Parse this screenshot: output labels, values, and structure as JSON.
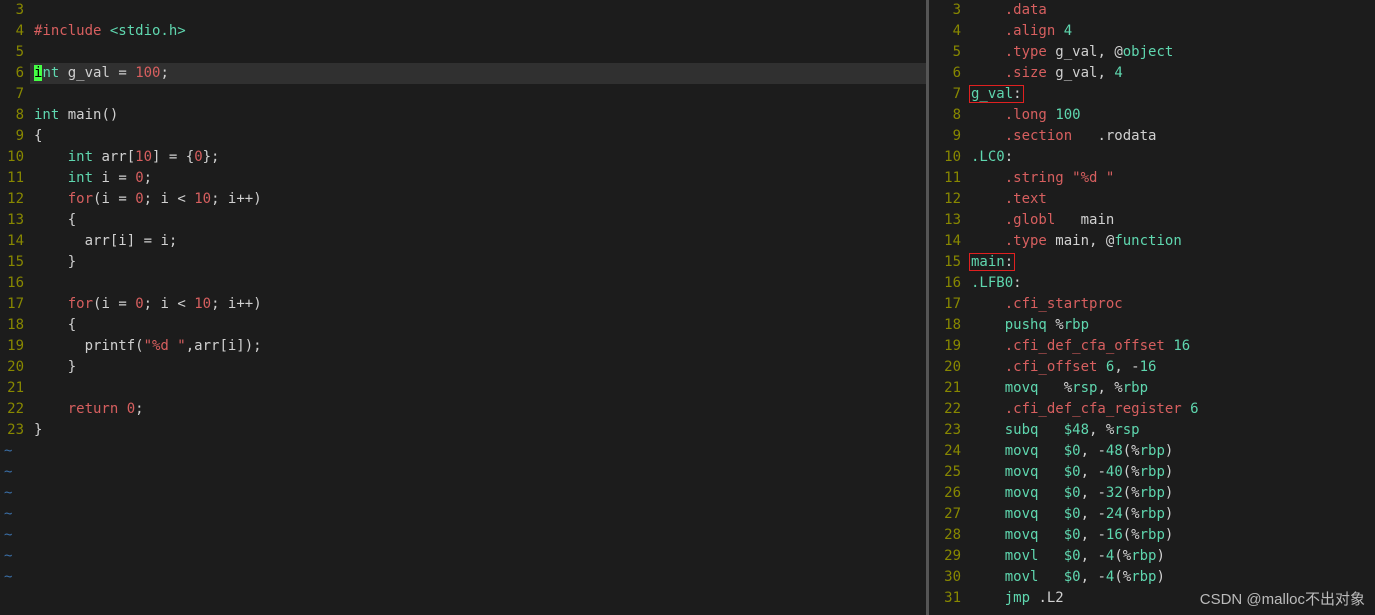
{
  "watermark": "CSDN @malloc不出对象",
  "left": {
    "lines": [
      {
        "n": 3,
        "tokens": []
      },
      {
        "n": 4,
        "tokens": [
          {
            "t": "#include ",
            "c": "pink"
          },
          {
            "t": "<stdio.h>",
            "c": "teal"
          }
        ]
      },
      {
        "n": 5,
        "tokens": []
      },
      {
        "n": 6,
        "hl": true,
        "tokens": [
          {
            "t": "i",
            "c": "cursor"
          },
          {
            "t": "nt",
            "c": "teal"
          },
          {
            "t": " g_val ",
            "c": "white"
          },
          {
            "t": "=",
            "c": "white"
          },
          {
            "t": " ",
            "c": "white"
          },
          {
            "t": "100",
            "c": "pink"
          },
          {
            "t": ";",
            "c": "white"
          }
        ]
      },
      {
        "n": 7,
        "tokens": []
      },
      {
        "n": 8,
        "tokens": [
          {
            "t": "int",
            "c": "teal"
          },
          {
            "t": " main()",
            "c": "white"
          }
        ]
      },
      {
        "n": 9,
        "tokens": [
          {
            "t": "{",
            "c": "white"
          }
        ]
      },
      {
        "n": 10,
        "tokens": [
          {
            "t": "    ",
            "c": "white"
          },
          {
            "t": "int",
            "c": "teal"
          },
          {
            "t": " arr[",
            "c": "white"
          },
          {
            "t": "10",
            "c": "pink"
          },
          {
            "t": "] ",
            "c": "white"
          },
          {
            "t": "=",
            "c": "white"
          },
          {
            "t": " {",
            "c": "white"
          },
          {
            "t": "0",
            "c": "pink"
          },
          {
            "t": "};",
            "c": "white"
          }
        ]
      },
      {
        "n": 11,
        "tokens": [
          {
            "t": "    ",
            "c": "white"
          },
          {
            "t": "int",
            "c": "teal"
          },
          {
            "t": " i ",
            "c": "white"
          },
          {
            "t": "=",
            "c": "white"
          },
          {
            "t": " ",
            "c": "white"
          },
          {
            "t": "0",
            "c": "pink"
          },
          {
            "t": ";",
            "c": "white"
          }
        ]
      },
      {
        "n": 12,
        "tokens": [
          {
            "t": "    ",
            "c": "white"
          },
          {
            "t": "for",
            "c": "pink"
          },
          {
            "t": "(i ",
            "c": "white"
          },
          {
            "t": "=",
            "c": "white"
          },
          {
            "t": " ",
            "c": "white"
          },
          {
            "t": "0",
            "c": "pink"
          },
          {
            "t": "; i ",
            "c": "white"
          },
          {
            "t": "<",
            "c": "white"
          },
          {
            "t": " ",
            "c": "white"
          },
          {
            "t": "10",
            "c": "pink"
          },
          {
            "t": "; i",
            "c": "white"
          },
          {
            "t": "++",
            "c": "white"
          },
          {
            "t": ")",
            "c": "white"
          }
        ]
      },
      {
        "n": 13,
        "tokens": [
          {
            "t": "    {",
            "c": "white"
          }
        ]
      },
      {
        "n": 14,
        "tokens": [
          {
            "t": "      arr[i] ",
            "c": "white"
          },
          {
            "t": "=",
            "c": "white"
          },
          {
            "t": " i;",
            "c": "white"
          }
        ]
      },
      {
        "n": 15,
        "tokens": [
          {
            "t": "    }",
            "c": "white"
          }
        ]
      },
      {
        "n": 16,
        "tokens": []
      },
      {
        "n": 17,
        "tokens": [
          {
            "t": "    ",
            "c": "white"
          },
          {
            "t": "for",
            "c": "pink"
          },
          {
            "t": "(i ",
            "c": "white"
          },
          {
            "t": "=",
            "c": "white"
          },
          {
            "t": " ",
            "c": "white"
          },
          {
            "t": "0",
            "c": "pink"
          },
          {
            "t": "; i ",
            "c": "white"
          },
          {
            "t": "<",
            "c": "white"
          },
          {
            "t": " ",
            "c": "white"
          },
          {
            "t": "10",
            "c": "pink"
          },
          {
            "t": "; i",
            "c": "white"
          },
          {
            "t": "++",
            "c": "white"
          },
          {
            "t": ")",
            "c": "white"
          }
        ]
      },
      {
        "n": 18,
        "tokens": [
          {
            "t": "    {",
            "c": "white"
          }
        ]
      },
      {
        "n": 19,
        "tokens": [
          {
            "t": "      printf(",
            "c": "white"
          },
          {
            "t": "\"%d \"",
            "c": "pink"
          },
          {
            "t": ",arr[i]);",
            "c": "white"
          }
        ]
      },
      {
        "n": 20,
        "tokens": [
          {
            "t": "    }",
            "c": "white"
          }
        ]
      },
      {
        "n": 21,
        "tokens": []
      },
      {
        "n": 22,
        "tokens": [
          {
            "t": "    ",
            "c": "white"
          },
          {
            "t": "return",
            "c": "pink"
          },
          {
            "t": " ",
            "c": "white"
          },
          {
            "t": "0",
            "c": "pink"
          },
          {
            "t": ";",
            "c": "white"
          }
        ]
      },
      {
        "n": 23,
        "tokens": [
          {
            "t": "}",
            "c": "white"
          }
        ]
      }
    ],
    "tildes": 7
  },
  "right": {
    "lines": [
      {
        "n": 3,
        "tokens": [
          {
            "t": "    ",
            "c": "white"
          },
          {
            "t": ".data",
            "c": "pink"
          }
        ]
      },
      {
        "n": 4,
        "tokens": [
          {
            "t": "    ",
            "c": "white"
          },
          {
            "t": ".align",
            "c": "pink"
          },
          {
            "t": " ",
            "c": "white"
          },
          {
            "t": "4",
            "c": "teal"
          }
        ]
      },
      {
        "n": 5,
        "tokens": [
          {
            "t": "    ",
            "c": "white"
          },
          {
            "t": ".type",
            "c": "pink"
          },
          {
            "t": " g_val, ",
            "c": "white"
          },
          {
            "t": "@",
            "c": "white"
          },
          {
            "t": "object",
            "c": "teal"
          }
        ]
      },
      {
        "n": 6,
        "tokens": [
          {
            "t": "    ",
            "c": "white"
          },
          {
            "t": ".size",
            "c": "pink"
          },
          {
            "t": " g_val, ",
            "c": "white"
          },
          {
            "t": "4",
            "c": "teal"
          }
        ]
      },
      {
        "n": 7,
        "box": true,
        "tokens": [
          {
            "t": "g_val",
            "c": "teal"
          },
          {
            "t": ":",
            "c": "white"
          }
        ]
      },
      {
        "n": 8,
        "tokens": [
          {
            "t": "    ",
            "c": "white"
          },
          {
            "t": ".long",
            "c": "pink"
          },
          {
            "t": " ",
            "c": "white"
          },
          {
            "t": "100",
            "c": "teal"
          }
        ]
      },
      {
        "n": 9,
        "tokens": [
          {
            "t": "    ",
            "c": "white"
          },
          {
            "t": ".section",
            "c": "pink"
          },
          {
            "t": "   .rodata",
            "c": "white"
          }
        ]
      },
      {
        "n": 10,
        "tokens": [
          {
            "t": ".LC0",
            "c": "teal"
          },
          {
            "t": ":",
            "c": "white"
          }
        ]
      },
      {
        "n": 11,
        "tokens": [
          {
            "t": "    ",
            "c": "white"
          },
          {
            "t": ".string",
            "c": "pink"
          },
          {
            "t": " ",
            "c": "white"
          },
          {
            "t": "\"%d \"",
            "c": "pink"
          }
        ]
      },
      {
        "n": 12,
        "tokens": [
          {
            "t": "    ",
            "c": "white"
          },
          {
            "t": ".text",
            "c": "pink"
          }
        ]
      },
      {
        "n": 13,
        "tokens": [
          {
            "t": "    ",
            "c": "white"
          },
          {
            "t": ".globl",
            "c": "pink"
          },
          {
            "t": "   main",
            "c": "white"
          }
        ]
      },
      {
        "n": 14,
        "tokens": [
          {
            "t": "    ",
            "c": "white"
          },
          {
            "t": ".type",
            "c": "pink"
          },
          {
            "t": " main, ",
            "c": "white"
          },
          {
            "t": "@",
            "c": "white"
          },
          {
            "t": "function",
            "c": "teal"
          }
        ]
      },
      {
        "n": 15,
        "box": true,
        "tokens": [
          {
            "t": "main",
            "c": "teal"
          },
          {
            "t": ":",
            "c": "white"
          }
        ]
      },
      {
        "n": 16,
        "tokens": [
          {
            "t": ".LFB0",
            "c": "teal"
          },
          {
            "t": ":",
            "c": "white"
          }
        ]
      },
      {
        "n": 17,
        "tokens": [
          {
            "t": "    ",
            "c": "white"
          },
          {
            "t": ".cfi_startproc",
            "c": "pink"
          }
        ]
      },
      {
        "n": 18,
        "tokens": [
          {
            "t": "    ",
            "c": "white"
          },
          {
            "t": "pushq",
            "c": "teal"
          },
          {
            "t": " %",
            "c": "white"
          },
          {
            "t": "rbp",
            "c": "teal"
          }
        ]
      },
      {
        "n": 19,
        "tokens": [
          {
            "t": "    ",
            "c": "white"
          },
          {
            "t": ".cfi_def_cfa_offset",
            "c": "pink"
          },
          {
            "t": " ",
            "c": "white"
          },
          {
            "t": "16",
            "c": "teal"
          }
        ]
      },
      {
        "n": 20,
        "tokens": [
          {
            "t": "    ",
            "c": "white"
          },
          {
            "t": ".cfi_offset",
            "c": "pink"
          },
          {
            "t": " ",
            "c": "white"
          },
          {
            "t": "6",
            "c": "teal"
          },
          {
            "t": ", -",
            "c": "white"
          },
          {
            "t": "16",
            "c": "teal"
          }
        ]
      },
      {
        "n": 21,
        "tokens": [
          {
            "t": "    ",
            "c": "white"
          },
          {
            "t": "movq",
            "c": "teal"
          },
          {
            "t": "   %",
            "c": "white"
          },
          {
            "t": "rsp",
            "c": "teal"
          },
          {
            "t": ", %",
            "c": "white"
          },
          {
            "t": "rbp",
            "c": "teal"
          }
        ]
      },
      {
        "n": 22,
        "tokens": [
          {
            "t": "    ",
            "c": "white"
          },
          {
            "t": ".cfi_def_cfa_register",
            "c": "pink"
          },
          {
            "t": " ",
            "c": "white"
          },
          {
            "t": "6",
            "c": "teal"
          }
        ]
      },
      {
        "n": 23,
        "tokens": [
          {
            "t": "    ",
            "c": "white"
          },
          {
            "t": "subq",
            "c": "teal"
          },
          {
            "t": "   ",
            "c": "white"
          },
          {
            "t": "$48",
            "c": "teal"
          },
          {
            "t": ", %",
            "c": "white"
          },
          {
            "t": "rsp",
            "c": "teal"
          }
        ]
      },
      {
        "n": 24,
        "tokens": [
          {
            "t": "    ",
            "c": "white"
          },
          {
            "t": "movq",
            "c": "teal"
          },
          {
            "t": "   ",
            "c": "white"
          },
          {
            "t": "$0",
            "c": "teal"
          },
          {
            "t": ", -",
            "c": "white"
          },
          {
            "t": "48",
            "c": "teal"
          },
          {
            "t": "(%",
            "c": "white"
          },
          {
            "t": "rbp",
            "c": "teal"
          },
          {
            "t": ")",
            "c": "white"
          }
        ]
      },
      {
        "n": 25,
        "tokens": [
          {
            "t": "    ",
            "c": "white"
          },
          {
            "t": "movq",
            "c": "teal"
          },
          {
            "t": "   ",
            "c": "white"
          },
          {
            "t": "$0",
            "c": "teal"
          },
          {
            "t": ", -",
            "c": "white"
          },
          {
            "t": "40",
            "c": "teal"
          },
          {
            "t": "(%",
            "c": "white"
          },
          {
            "t": "rbp",
            "c": "teal"
          },
          {
            "t": ")",
            "c": "white"
          }
        ]
      },
      {
        "n": 26,
        "tokens": [
          {
            "t": "    ",
            "c": "white"
          },
          {
            "t": "movq",
            "c": "teal"
          },
          {
            "t": "   ",
            "c": "white"
          },
          {
            "t": "$0",
            "c": "teal"
          },
          {
            "t": ", -",
            "c": "white"
          },
          {
            "t": "32",
            "c": "teal"
          },
          {
            "t": "(%",
            "c": "white"
          },
          {
            "t": "rbp",
            "c": "teal"
          },
          {
            "t": ")",
            "c": "white"
          }
        ]
      },
      {
        "n": 27,
        "tokens": [
          {
            "t": "    ",
            "c": "white"
          },
          {
            "t": "movq",
            "c": "teal"
          },
          {
            "t": "   ",
            "c": "white"
          },
          {
            "t": "$0",
            "c": "teal"
          },
          {
            "t": ", -",
            "c": "white"
          },
          {
            "t": "24",
            "c": "teal"
          },
          {
            "t": "(%",
            "c": "white"
          },
          {
            "t": "rbp",
            "c": "teal"
          },
          {
            "t": ")",
            "c": "white"
          }
        ]
      },
      {
        "n": 28,
        "tokens": [
          {
            "t": "    ",
            "c": "white"
          },
          {
            "t": "movq",
            "c": "teal"
          },
          {
            "t": "   ",
            "c": "white"
          },
          {
            "t": "$0",
            "c": "teal"
          },
          {
            "t": ", -",
            "c": "white"
          },
          {
            "t": "16",
            "c": "teal"
          },
          {
            "t": "(%",
            "c": "white"
          },
          {
            "t": "rbp",
            "c": "teal"
          },
          {
            "t": ")",
            "c": "white"
          }
        ]
      },
      {
        "n": 29,
        "tokens": [
          {
            "t": "    ",
            "c": "white"
          },
          {
            "t": "movl",
            "c": "teal"
          },
          {
            "t": "   ",
            "c": "white"
          },
          {
            "t": "$0",
            "c": "teal"
          },
          {
            "t": ", -",
            "c": "white"
          },
          {
            "t": "4",
            "c": "teal"
          },
          {
            "t": "(%",
            "c": "white"
          },
          {
            "t": "rbp",
            "c": "teal"
          },
          {
            "t": ")",
            "c": "white"
          }
        ]
      },
      {
        "n": 30,
        "tokens": [
          {
            "t": "    ",
            "c": "white"
          },
          {
            "t": "movl",
            "c": "teal"
          },
          {
            "t": "   ",
            "c": "white"
          },
          {
            "t": "$0",
            "c": "teal"
          },
          {
            "t": ", -",
            "c": "white"
          },
          {
            "t": "4",
            "c": "teal"
          },
          {
            "t": "(%",
            "c": "white"
          },
          {
            "t": "rbp",
            "c": "teal"
          },
          {
            "t": ")",
            "c": "white"
          }
        ]
      },
      {
        "n": 31,
        "tokens": [
          {
            "t": "    ",
            "c": "white"
          },
          {
            "t": "jmp",
            "c": "teal"
          },
          {
            "t": " .L2",
            "c": "white"
          }
        ]
      }
    ]
  }
}
